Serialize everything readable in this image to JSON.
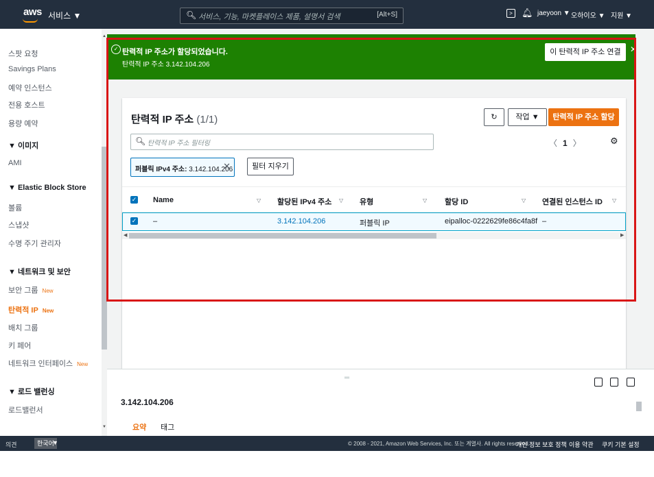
{
  "topnav": {
    "logo": "aws",
    "services": "서비스 ▼",
    "search_placeholder": "서비스, 기능, 마켓플레이스 제품, 설명서 검색",
    "search_shortcut": "[Alt+S]",
    "user": "jaeyoon ▼",
    "region": "오하이오 ▼",
    "support": "지원 ▼"
  },
  "sidebar": {
    "items": [
      {
        "label": "스팟 요청",
        "type": "item"
      },
      {
        "label": "Savings Plans",
        "type": "item"
      },
      {
        "label": "예약 인스턴스",
        "type": "item"
      },
      {
        "label": "전용 호스트",
        "type": "item"
      },
      {
        "label": "용량 예약",
        "type": "item"
      },
      {
        "label": "▼ 이미지",
        "type": "head"
      },
      {
        "label": "AMI",
        "type": "item"
      },
      {
        "label": "▼ Elastic Block Store",
        "type": "head"
      },
      {
        "label": "볼륨",
        "type": "item"
      },
      {
        "label": "스냅샷",
        "type": "item"
      },
      {
        "label": "수명 주기 관리자",
        "type": "item"
      },
      {
        "label": "▼ 네트워크 및 보안",
        "type": "head"
      },
      {
        "label": "보안 그룹",
        "type": "item",
        "badge": "New"
      },
      {
        "label": "탄력적 IP",
        "type": "active",
        "badge": "New"
      },
      {
        "label": "배치 그룹",
        "type": "item"
      },
      {
        "label": "키 페어",
        "type": "item"
      },
      {
        "label": "네트워크 인터페이스",
        "type": "item",
        "badge": "New"
      },
      {
        "label": "▼ 로드 밸런싱",
        "type": "head"
      },
      {
        "label": "로드밸런서",
        "type": "item"
      }
    ]
  },
  "flash": {
    "title": "탄력적 IP 주소가 할당되었습니다.",
    "subtitle": "탄력적 IP 주소 3.142.104.206",
    "action": "이 탄력적 IP 주소 연결",
    "color": "#1d8102"
  },
  "panel": {
    "title": "탄력적 IP 주소",
    "count": "(1/1)",
    "refresh": "↻",
    "actions": "작업 ▼",
    "allocate": "탄력적 IP 주소 할당",
    "filter_placeholder": "탄력적 IP 주소 필터링",
    "page": "1",
    "token_label": "퍼블릭 IPv4 주소:",
    "token_value": "3.142.104.206",
    "clear_filters": "필터 지우기"
  },
  "table": {
    "columns": [
      "Name",
      "할당된 IPv4 주소",
      "유형",
      "할당 ID",
      "연결된 인스턴스 ID"
    ],
    "rows": [
      {
        "name": "–",
        "ipv4": "3.142.104.206",
        "type": "퍼블릭 IP",
        "alloc_id": "eipalloc-0222629fe86c4fa8f",
        "instance": "–"
      }
    ]
  },
  "detail": {
    "title": "3.142.104.206",
    "tabs": [
      "요약",
      "태그"
    ]
  },
  "footer": {
    "feedback": "의견",
    "language": "한국어",
    "copyright": "© 2008 - 2021, Amazon Web Services, Inc. 또는 계열사. All rights reserved.",
    "privacy": "개인 정보 보호 정책",
    "terms": "이용 약관",
    "cookies": "쿠키 기본 설정"
  },
  "colors": {
    "accent": "#ec7211",
    "link": "#0073bb",
    "highlight_box": "#d91515",
    "nav_bg": "#232f3e"
  }
}
